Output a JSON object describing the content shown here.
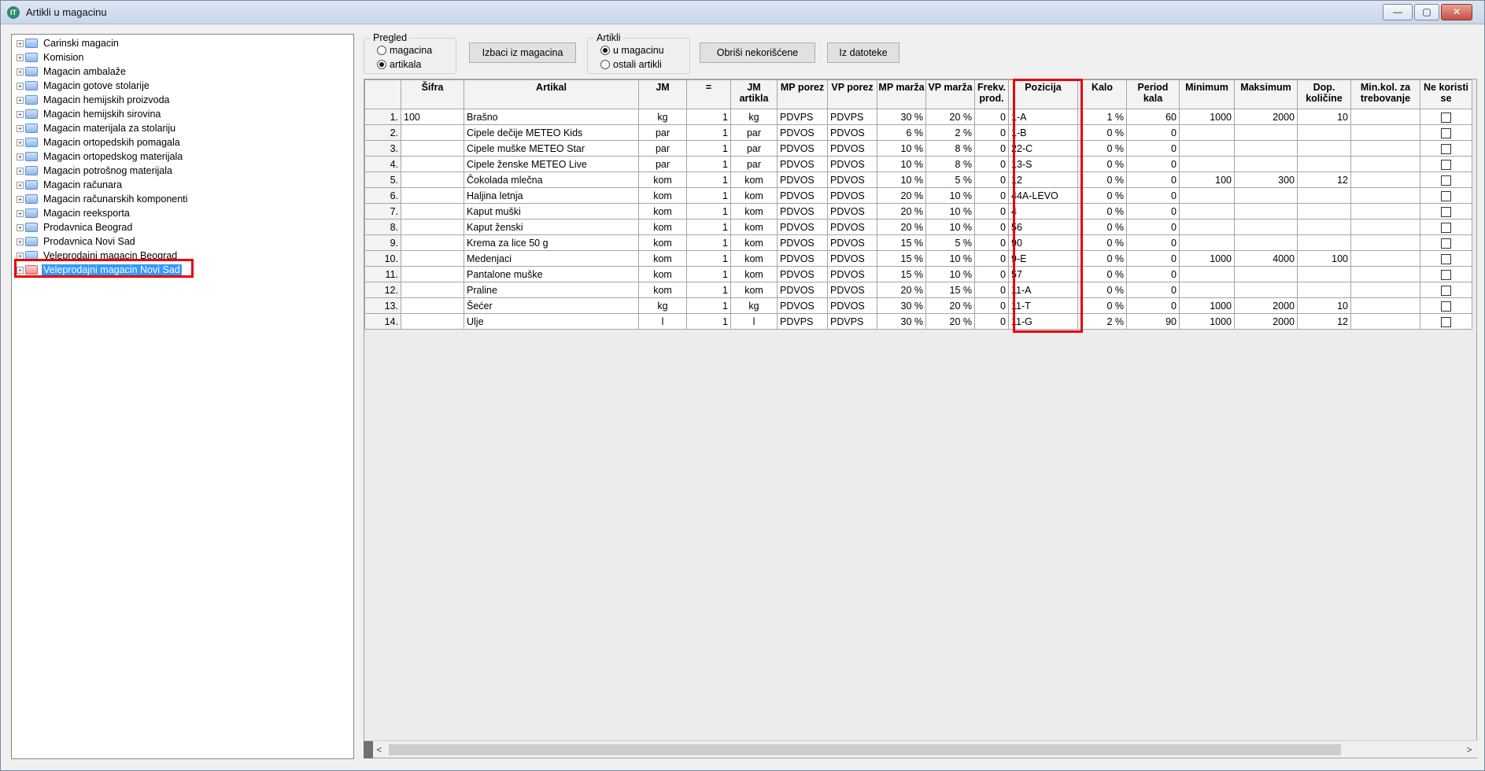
{
  "window": {
    "title": "Artikli u magacinu",
    "app_icon_text": "IT",
    "min_glyph": "—",
    "max_glyph": "▢",
    "close_glyph": "✕"
  },
  "tree": {
    "items": [
      {
        "label": "Carinski magacin",
        "icon": "warehouse-icon"
      },
      {
        "label": "Komision",
        "icon": "warehouse-icon"
      },
      {
        "label": "Magacin ambalaže",
        "icon": "warehouse-icon"
      },
      {
        "label": "Magacin gotove stolarije",
        "icon": "warehouse-icon"
      },
      {
        "label": "Magacin hemijskih proizvoda",
        "icon": "warehouse-icon"
      },
      {
        "label": "Magacin hemijskih sirovina",
        "icon": "warehouse-icon"
      },
      {
        "label": "Magacin materijala za stolariju",
        "icon": "warehouse-icon"
      },
      {
        "label": "Magacin ortopedskih pomagala",
        "icon": "warehouse-icon"
      },
      {
        "label": "Magacin ortopedskog materijala",
        "icon": "warehouse-icon"
      },
      {
        "label": "Magacin potrošnog materijala",
        "icon": "warehouse-icon"
      },
      {
        "label": "Magacin računara",
        "icon": "warehouse-icon"
      },
      {
        "label": "Magacin računarskih komponenti",
        "icon": "warehouse-icon"
      },
      {
        "label": "Magacin reeksporta",
        "icon": "warehouse-icon"
      },
      {
        "label": "Prodavnica Beograd",
        "icon": "warehouse-icon"
      },
      {
        "label": "Prodavnica Novi Sad",
        "icon": "warehouse-icon"
      },
      {
        "label": "Veleprodajni magacin Beograd",
        "icon": "warehouse-icon"
      },
      {
        "label": "Veleprodajni magacin Novi Sad",
        "icon": "warehouse-icon",
        "selected": true
      }
    ],
    "expander_glyph": "+"
  },
  "pregled": {
    "title": "Pregled",
    "options": [
      "magacina",
      "artikala"
    ],
    "selected": "artikala"
  },
  "artikli": {
    "title": "Artikli",
    "options": [
      "u magacinu",
      "ostali artikli"
    ],
    "selected": "u magacinu"
  },
  "buttons": {
    "izbaci": "Izbaci iz magacina",
    "obrisi": "Obriši nekorišćene",
    "iz_datoteke": "Iz datoteke"
  },
  "grid": {
    "columns": [
      "",
      "Šifra",
      "Artikal",
      "JM",
      "=",
      "JM artikla",
      "MP porez",
      "VP porez",
      "MP marža",
      "VP marža",
      "Frekv. prod.",
      "Pozicija",
      "Kalo",
      "Period kala",
      "Minimum",
      "Maksimum",
      "Dop. količine",
      "Min.kol. za trebovanje",
      "Ne koristi se"
    ],
    "rows": [
      {
        "n": "1.",
        "sifra": "100",
        "artikal": "Brašno",
        "jm": "kg",
        "eq": "1",
        "jma": "kg",
        "mp": "PDVPS",
        "vp": "PDVPS",
        "mpm": "30 %",
        "vpm": "20 %",
        "frekv": "0",
        "poz": "1-A",
        "kalo": "1 %",
        "period": "60",
        "min": "1000",
        "max": "2000",
        "dop": "10",
        "minkol": ""
      },
      {
        "n": "2.",
        "sifra": "",
        "artikal": "Cipele dečije METEO Kids",
        "jm": "par",
        "eq": "1",
        "jma": "par",
        "mp": "PDVOS",
        "vp": "PDVOS",
        "mpm": "6 %",
        "vpm": "2 %",
        "frekv": "0",
        "poz": "1-B",
        "kalo": "0 %",
        "period": "0",
        "min": "",
        "max": "",
        "dop": "",
        "minkol": ""
      },
      {
        "n": "3.",
        "sifra": "",
        "artikal": "Cipele muške METEO Star",
        "jm": "par",
        "eq": "1",
        "jma": "par",
        "mp": "PDVOS",
        "vp": "PDVOS",
        "mpm": "10 %",
        "vpm": "8 %",
        "frekv": "0",
        "poz": "22-C",
        "kalo": "0 %",
        "period": "0",
        "min": "",
        "max": "",
        "dop": "",
        "minkol": ""
      },
      {
        "n": "4.",
        "sifra": "",
        "artikal": "Cipele ženske METEO Live",
        "jm": "par",
        "eq": "1",
        "jma": "par",
        "mp": "PDVOS",
        "vp": "PDVOS",
        "mpm": "10 %",
        "vpm": "8 %",
        "frekv": "0",
        "poz": "13-S",
        "kalo": "0 %",
        "period": "0",
        "min": "",
        "max": "",
        "dop": "",
        "minkol": ""
      },
      {
        "n": "5.",
        "sifra": "",
        "artikal": "Čokolada mlečna",
        "jm": "kom",
        "eq": "1",
        "jma": "kom",
        "mp": "PDVOS",
        "vp": "PDVOS",
        "mpm": "10 %",
        "vpm": "5 %",
        "frekv": "0",
        "poz": "12",
        "kalo": "0 %",
        "period": "0",
        "min": "100",
        "max": "300",
        "dop": "12",
        "minkol": ""
      },
      {
        "n": "6.",
        "sifra": "",
        "artikal": "Haljina letnja",
        "jm": "kom",
        "eq": "1",
        "jma": "kom",
        "mp": "PDVOS",
        "vp": "PDVOS",
        "mpm": "20 %",
        "vpm": "10 %",
        "frekv": "0",
        "poz": "44A-LEVO",
        "kalo": "0 %",
        "period": "0",
        "min": "",
        "max": "",
        "dop": "",
        "minkol": ""
      },
      {
        "n": "7.",
        "sifra": "",
        "artikal": "Kaput muški",
        "jm": "kom",
        "eq": "1",
        "jma": "kom",
        "mp": "PDVOS",
        "vp": "PDVOS",
        "mpm": "20 %",
        "vpm": "10 %",
        "frekv": "0",
        "poz": "4",
        "kalo": "0 %",
        "period": "0",
        "min": "",
        "max": "",
        "dop": "",
        "minkol": ""
      },
      {
        "n": "8.",
        "sifra": "",
        "artikal": "Kaput ženski",
        "jm": "kom",
        "eq": "1",
        "jma": "kom",
        "mp": "PDVOS",
        "vp": "PDVOS",
        "mpm": "20 %",
        "vpm": "10 %",
        "frekv": "0",
        "poz": "56",
        "kalo": "0 %",
        "period": "0",
        "min": "",
        "max": "",
        "dop": "",
        "minkol": ""
      },
      {
        "n": "9.",
        "sifra": "",
        "artikal": "Krema za lice 50 g",
        "jm": "kom",
        "eq": "1",
        "jma": "kom",
        "mp": "PDVOS",
        "vp": "PDVOS",
        "mpm": "15 %",
        "vpm": "5 %",
        "frekv": "0",
        "poz": "90",
        "kalo": "0 %",
        "period": "0",
        "min": "",
        "max": "",
        "dop": "",
        "minkol": ""
      },
      {
        "n": "10.",
        "sifra": "",
        "artikal": "Medenjaci",
        "jm": "kom",
        "eq": "1",
        "jma": "kom",
        "mp": "PDVOS",
        "vp": "PDVOS",
        "mpm": "15 %",
        "vpm": "10 %",
        "frekv": "0",
        "poz": "9-E",
        "kalo": "0 %",
        "period": "0",
        "min": "1000",
        "max": "4000",
        "dop": "100",
        "minkol": ""
      },
      {
        "n": "11.",
        "sifra": "",
        "artikal": "Pantalone muške",
        "jm": "kom",
        "eq": "1",
        "jma": "kom",
        "mp": "PDVOS",
        "vp": "PDVOS",
        "mpm": "15 %",
        "vpm": "10 %",
        "frekv": "0",
        "poz": "57",
        "kalo": "0 %",
        "period": "0",
        "min": "",
        "max": "",
        "dop": "",
        "minkol": ""
      },
      {
        "n": "12.",
        "sifra": "",
        "artikal": "Praline",
        "jm": "kom",
        "eq": "1",
        "jma": "kom",
        "mp": "PDVOS",
        "vp": "PDVOS",
        "mpm": "20 %",
        "vpm": "15 %",
        "frekv": "0",
        "poz": "11-A",
        "kalo": "0 %",
        "period": "0",
        "min": "",
        "max": "",
        "dop": "",
        "minkol": ""
      },
      {
        "n": "13.",
        "sifra": "",
        "artikal": "Šećer",
        "jm": "kg",
        "eq": "1",
        "jma": "kg",
        "mp": "PDVOS",
        "vp": "PDVOS",
        "mpm": "30 %",
        "vpm": "20 %",
        "frekv": "0",
        "poz": "11-T",
        "kalo": "0 %",
        "period": "0",
        "min": "1000",
        "max": "2000",
        "dop": "10",
        "minkol": ""
      },
      {
        "n": "14.",
        "sifra": "",
        "artikal": "Ulje",
        "jm": "l",
        "eq": "1",
        "jma": "l",
        "mp": "PDVPS",
        "vp": "PDVPS",
        "mpm": "30 %",
        "vpm": "20 %",
        "frekv": "0",
        "poz": "11-G",
        "kalo": "2 %",
        "period": "90",
        "min": "1000",
        "max": "2000",
        "dop": "12",
        "minkol": ""
      }
    ]
  },
  "scrollbar": {
    "left_arrow": "<",
    "right_arrow": ">"
  },
  "colors": {
    "highlight": "#e8000a",
    "selection": "#3399ff"
  }
}
